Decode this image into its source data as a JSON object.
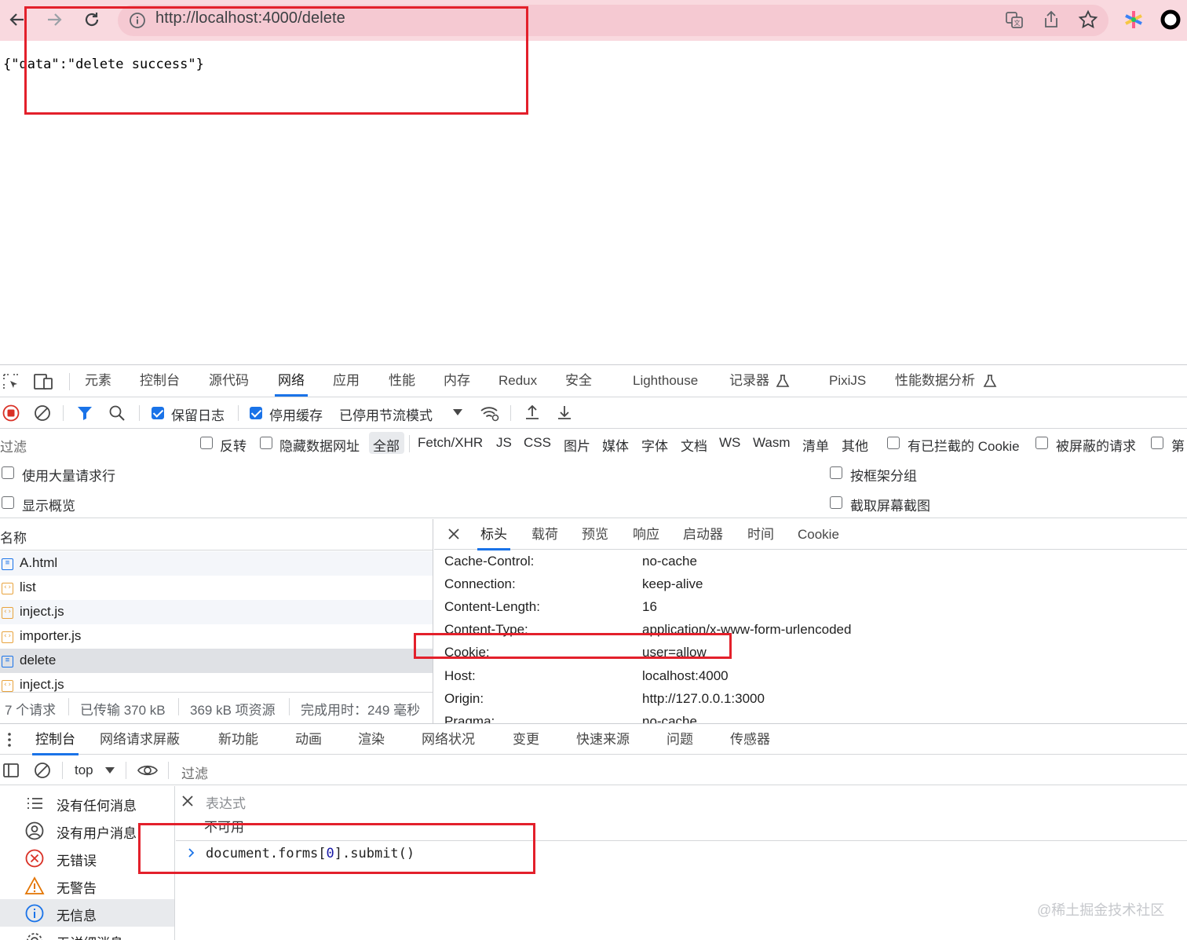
{
  "browser": {
    "url": "http://localhost:4000/delete",
    "back_icon": "back-arrow-icon",
    "forward_icon": "forward-arrow-icon",
    "reload_icon": "reload-icon"
  },
  "page": {
    "json_text": "{\"data\":\"delete success\"}"
  },
  "devtools": {
    "main_tabs": [
      "元素",
      "控制台",
      "源代码",
      "网络",
      "应用",
      "性能",
      "内存",
      "Redux",
      "安全",
      "Lighthouse",
      "记录器",
      "PixiJS",
      "性能数据分析"
    ],
    "active_tab": "网络",
    "toolbar": {
      "preserve_log": "保留日志",
      "disable_cache": "停用缓存",
      "throttle": "已停用节流模式"
    },
    "filter": {
      "placeholder": "过滤",
      "invert": "反转",
      "hide_data_urls": "隐藏数据网址",
      "types": [
        "全部",
        "Fetch/XHR",
        "JS",
        "CSS",
        "图片",
        "媒体",
        "字体",
        "文档",
        "WS",
        "Wasm",
        "清单",
        "其他"
      ],
      "blocked_cookies": "有已拦截的 Cookie",
      "blocked_requests": "被屏蔽的请求",
      "third_party": "第"
    },
    "options": {
      "big_rows": "使用大量请求行",
      "group_by_frame": "按框架分组",
      "overview": "显示概览",
      "screenshots": "截取屏幕截图"
    },
    "requests": {
      "header": "名称",
      "items": [
        {
          "name": "A.html",
          "kind": "doc"
        },
        {
          "name": "list",
          "kind": "script"
        },
        {
          "name": "inject.js",
          "kind": "script"
        },
        {
          "name": "importer.js",
          "kind": "script"
        },
        {
          "name": "delete",
          "kind": "doc"
        },
        {
          "name": "inject.js",
          "kind": "script"
        }
      ],
      "status": {
        "count": "7 个请求",
        "transferred": "已传输 370 kB",
        "resources": "369 kB 项资源",
        "finish": "完成用时：249 毫秒"
      }
    },
    "detail_tabs": [
      "标头",
      "载荷",
      "预览",
      "响应",
      "启动器",
      "时间",
      "Cookie"
    ],
    "headers": [
      {
        "k": "Cache-Control:",
        "v": "no-cache"
      },
      {
        "k": "Connection:",
        "v": "keep-alive"
      },
      {
        "k": "Content-Length:",
        "v": "16"
      },
      {
        "k": "Content-Type:",
        "v": "application/x-www-form-urlencoded"
      },
      {
        "k": "Cookie:",
        "v": "user=allow"
      },
      {
        "k": "Host:",
        "v": "localhost:4000"
      },
      {
        "k": "Origin:",
        "v": "http://127.0.0.1:3000"
      },
      {
        "k": "Pragma:",
        "v": "no-cache"
      }
    ],
    "drawer_tabs": [
      "控制台",
      "网络请求屏蔽",
      "新功能",
      "动画",
      "渲染",
      "网络状况",
      "变更",
      "快速来源",
      "问题",
      "传感器"
    ],
    "console": {
      "context": "top",
      "filter_placeholder": "过滤",
      "sidebar": [
        "没有任何消息",
        "没有用户消息",
        "无错误",
        "无警告",
        "无信息",
        "无详细消息"
      ],
      "expression_placeholder": "表达式",
      "expression_value": "不可用",
      "input_prefix": "document.forms[",
      "input_index": "0",
      "input_suffix": "].submit()"
    }
  },
  "watermark": "@稀土掘金技术社区"
}
